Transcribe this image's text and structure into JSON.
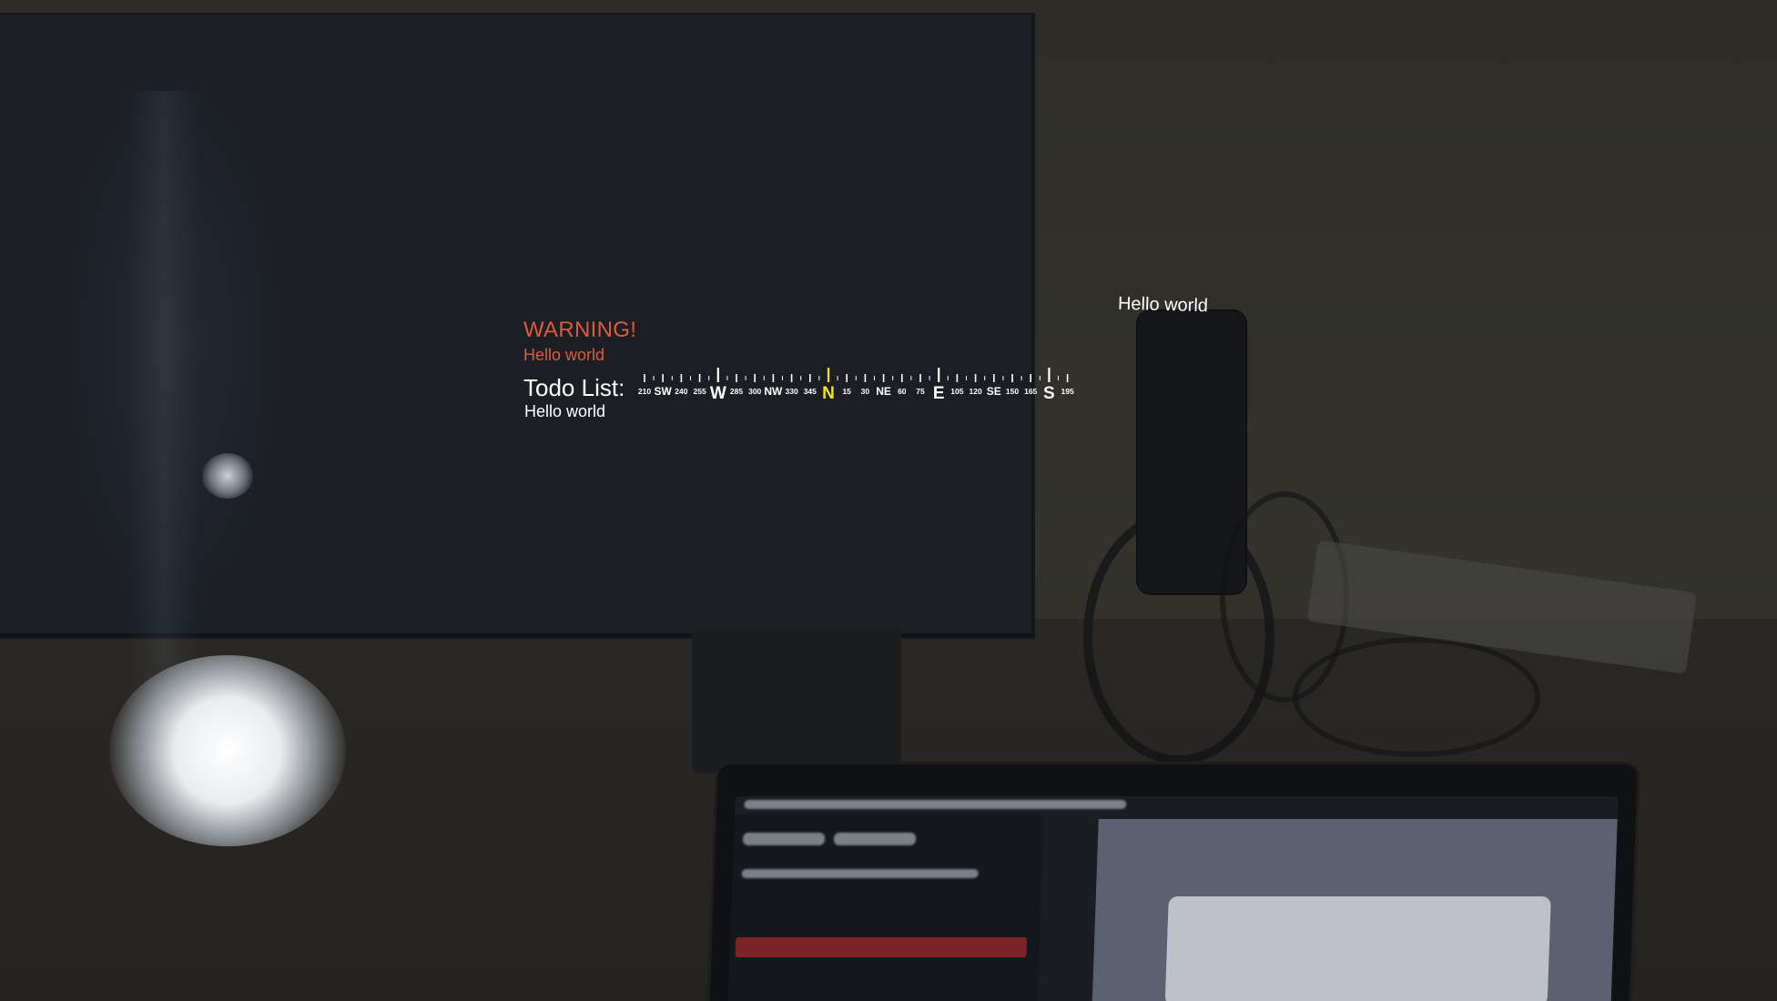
{
  "hud": {
    "warning_title": "WARNING!",
    "warning_message": "Hello world",
    "todo_label": "Todo List:",
    "todo_item": "Hello world",
    "floating_label": "Hello world"
  },
  "compass": {
    "heading_label": "N",
    "highlight_color": "#f4e21c",
    "ticks": [
      "210",
      "SW",
      "240",
      "255",
      "W",
      "285",
      "300",
      "NW",
      "330",
      "345",
      "N",
      "15",
      "30",
      "NE",
      "60",
      "75",
      "E",
      "105",
      "120",
      "SE",
      "150",
      "165",
      "S",
      "195"
    ]
  },
  "colors": {
    "warning": "#de5a3e",
    "text": "#ffffff"
  }
}
